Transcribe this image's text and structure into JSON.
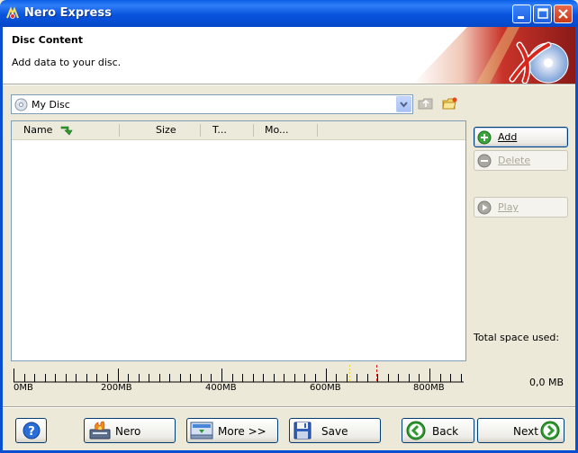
{
  "window": {
    "title": "Nero Express"
  },
  "header": {
    "title": "Disc Content",
    "subtitle": "Add data to your disc."
  },
  "disc_selector": {
    "selected": "My Disc"
  },
  "file_list": {
    "columns": [
      "Name",
      "Size",
      "T...",
      "Mo..."
    ],
    "rows": []
  },
  "scale": {
    "labels": [
      "0MB",
      "200MB",
      "400MB",
      "600MB",
      "800MB"
    ]
  },
  "side_buttons": {
    "add": "Add",
    "delete": "Delete",
    "play": "Play"
  },
  "space": {
    "label": "Total space used:",
    "value": "0,0 MB"
  },
  "footer": {
    "nero": "Nero",
    "more": "More >>",
    "save": "Save",
    "back": "Back",
    "next": "Next"
  }
}
